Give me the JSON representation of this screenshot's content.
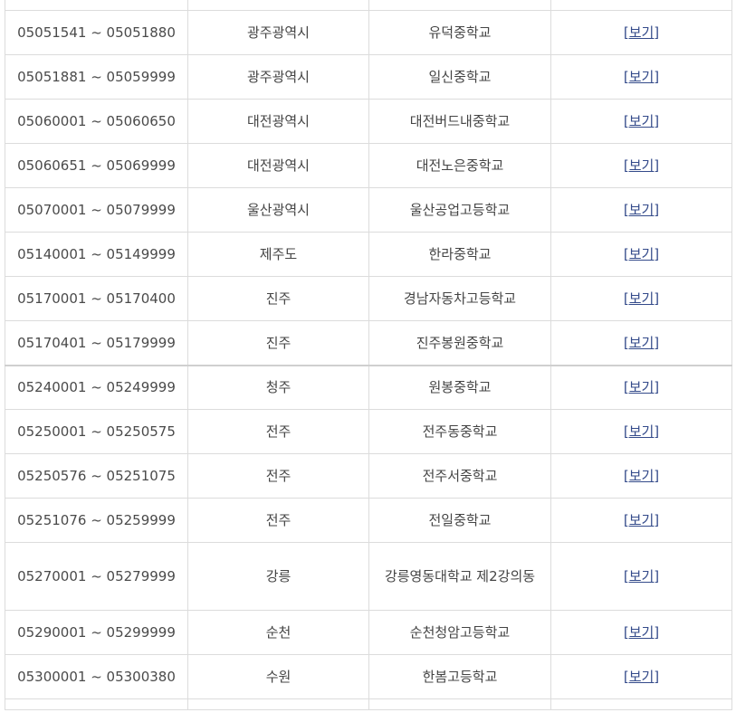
{
  "rows": [
    {
      "range": "05051541 ~ 05051880",
      "region": "광주광역시",
      "school": "유덕중학교",
      "link": "[보기]"
    },
    {
      "range": "05051881 ~ 05059999",
      "region": "광주광역시",
      "school": "일신중학교",
      "link": "[보기]"
    },
    {
      "range": "05060001 ~ 05060650",
      "region": "대전광역시",
      "school": "대전버드내중학교",
      "link": "[보기]"
    },
    {
      "range": "05060651 ~ 05069999",
      "region": "대전광역시",
      "school": "대전노은중학교",
      "link": "[보기]"
    },
    {
      "range": "05070001 ~ 05079999",
      "region": "울산광역시",
      "school": "울산공업고등학교",
      "link": "[보기]"
    },
    {
      "range": "05140001 ~ 05149999",
      "region": "제주도",
      "school": "한라중학교",
      "link": "[보기]"
    },
    {
      "range": "05170001 ~ 05170400",
      "region": "진주",
      "school": "경남자동차고등학교",
      "link": "[보기]"
    },
    {
      "range": "05170401 ~ 05179999",
      "region": "진주",
      "school": "진주봉원중학교",
      "link": "[보기]"
    },
    {
      "range": "05240001 ~ 05249999",
      "region": "청주",
      "school": "원봉중학교",
      "link": "[보기]"
    },
    {
      "range": "05250001 ~ 05250575",
      "region": "전주",
      "school": "전주동중학교",
      "link": "[보기]"
    },
    {
      "range": "05250576 ~ 05251075",
      "region": "전주",
      "school": "전주서중학교",
      "link": "[보기]"
    },
    {
      "range": "05251076 ~ 05259999",
      "region": "전주",
      "school": "전일중학교",
      "link": "[보기]"
    },
    {
      "range": "05270001 ~ 05279999",
      "region": "강릉",
      "school": "강릉영동대학교 제2강의동",
      "link": "[보기]"
    },
    {
      "range": "05290001 ~ 05299999",
      "region": "순천",
      "school": "순천청암고등학교",
      "link": "[보기]"
    },
    {
      "range": "05300001 ~ 05300380",
      "region": "수원",
      "school": "한봄고등학교",
      "link": "[보기]"
    }
  ]
}
